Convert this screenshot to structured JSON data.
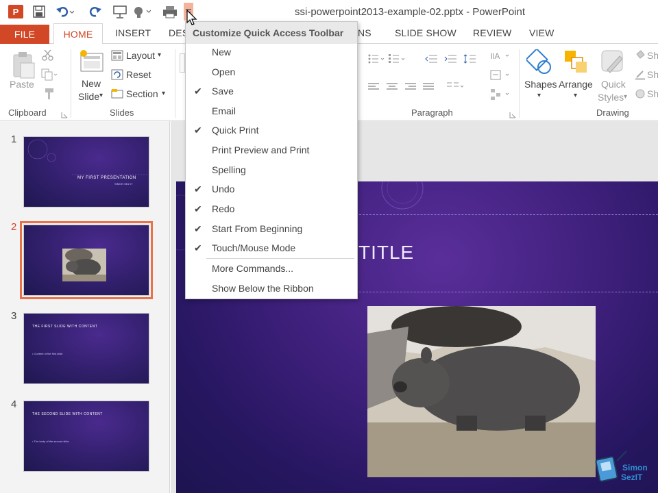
{
  "window": {
    "title": "ssi-powerpoint2013-example-02.pptx - PowerPoint"
  },
  "qat": {
    "icons": [
      "powerpoint-logo-icon",
      "save-icon",
      "undo-icon",
      "redo-icon",
      "start-from-beginning-icon",
      "touch-mouse-mode-icon",
      "quick-print-icon",
      "customize-qat-icon"
    ]
  },
  "tabs": [
    "FILE",
    "HOME",
    "INSERT",
    "DES",
    "NS",
    "SLIDE SHOW",
    "REVIEW",
    "VIEW"
  ],
  "ribbon": {
    "clipboard": {
      "paste": "Paste",
      "label": "Clipboard"
    },
    "slides": {
      "new_slide_line1": "New",
      "new_slide_line2": "Slide",
      "layout": "Layout",
      "reset": "Reset",
      "section": "Section",
      "label": "Slides"
    },
    "paragraph": {
      "label": "Paragraph"
    },
    "drawing": {
      "shapes": "Shapes",
      "arrange": "Arrange",
      "quick_line1": "Quick",
      "quick_line2": "Styles",
      "sh1": "Sh",
      "sh2": "Sh",
      "sh3": "Sh",
      "label": "Drawing"
    }
  },
  "menu": {
    "header": "Customize Quick Access Toolbar",
    "items": [
      {
        "label": "New",
        "checked": false
      },
      {
        "label": "Open",
        "checked": false
      },
      {
        "label": "Save",
        "checked": true
      },
      {
        "label": "Email",
        "checked": false
      },
      {
        "label": "Quick Print",
        "checked": true
      },
      {
        "label": "Print Preview and Print",
        "checked": false
      },
      {
        "label": "Spelling",
        "checked": false
      },
      {
        "label": "Undo",
        "checked": true
      },
      {
        "label": "Redo",
        "checked": true
      },
      {
        "label": "Start From Beginning",
        "checked": true
      },
      {
        "label": "Touch/Mouse Mode",
        "checked": true
      },
      {
        "label": "More Commands...",
        "checked": false
      },
      {
        "label": "Show Below the Ribbon",
        "checked": false
      }
    ],
    "check_glyph": "✔"
  },
  "slides_panel": {
    "thumbnails": [
      {
        "number": "1",
        "title": "MY FIRST PRESENTATION",
        "subtitle": "SIMON SEZ IT"
      },
      {
        "number": "2",
        "title": "",
        "subtitle": ""
      },
      {
        "number": "3",
        "title": "THE FIRST SLIDE WITH CONTENT",
        "subtitle": "• Content of the first slide"
      },
      {
        "number": "4",
        "title": "THE SECOND SLIDE WITH CONTENT",
        "subtitle": "• The body of the second slide"
      }
    ]
  },
  "slide": {
    "title": "TITLE"
  },
  "logo": {
    "line1": "Simon",
    "line2": "SezIT"
  },
  "colors": {
    "accent": "#d24726",
    "slide_bg": "#3d1f7a"
  }
}
